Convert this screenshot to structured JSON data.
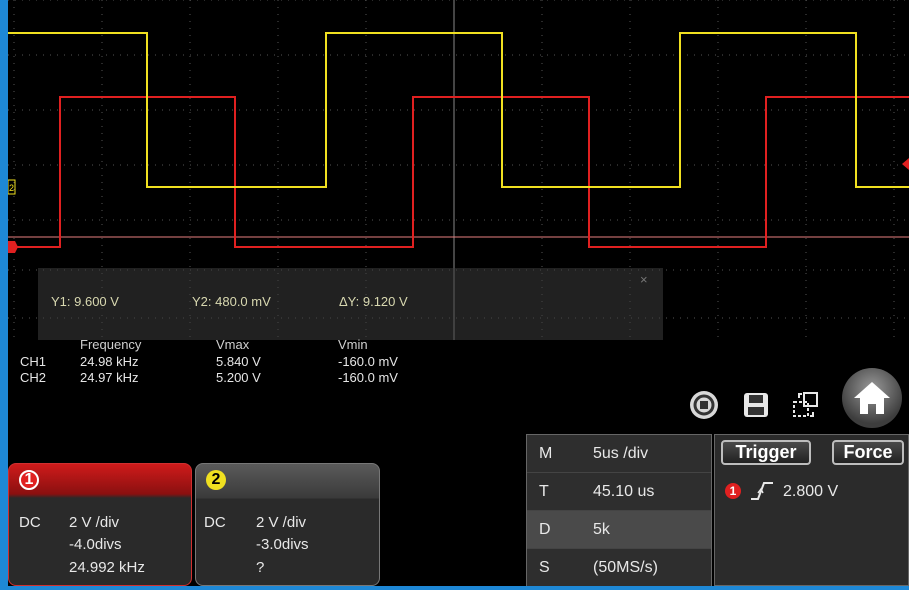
{
  "cursor": {
    "close_glyph": "×",
    "y1": "Y1: 9.600 V",
    "y2": "Y2: 480.0 mV",
    "dy": "ΔY: 9.120 V"
  },
  "measurements": {
    "headers": [
      "Frequency",
      "Vmax",
      "Vmin"
    ],
    "rows": [
      {
        "ch": "CH1",
        "freq": "24.98 kHz",
        "vmax": "5.840 V",
        "vmin": "-160.0 mV"
      },
      {
        "ch": "CH2",
        "freq": "24.97 kHz",
        "vmax": "5.200 V",
        "vmin": "-160.0 mV"
      }
    ]
  },
  "channel_marker": "2",
  "channels": [
    {
      "badge": "1",
      "coupling": "DC",
      "scale": "2 V /div",
      "offset": "-4.0divs",
      "info": "24.992 kHz",
      "color": "#e02020"
    },
    {
      "badge": "2",
      "coupling": "DC",
      "scale": "2 V /div",
      "offset": "-3.0divs",
      "info": "?",
      "color": "#f0e020"
    }
  ],
  "timebase": [
    {
      "key": "M",
      "value": "5us /div"
    },
    {
      "key": "T",
      "value": "45.10 us"
    },
    {
      "key": "D",
      "value": "5k"
    },
    {
      "key": "S",
      "value": "(50MS/s)"
    }
  ],
  "trigger": {
    "trigger_label": "Trigger",
    "force_label": "Force",
    "source_badge": "1",
    "level": "2.800 V"
  },
  "icons": [
    "auto-set-icon",
    "save-icon",
    "window-icon",
    "home-icon"
  ],
  "colors": {
    "ch1": "#e02020",
    "ch2": "#f0e020",
    "accent": "#1e88d6"
  }
}
